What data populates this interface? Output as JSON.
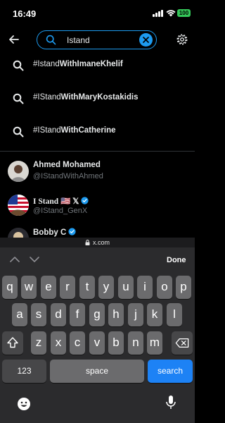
{
  "status_bar": {
    "time": "16:49",
    "battery": "100"
  },
  "search": {
    "query": "Istand"
  },
  "suggestions": [
    {
      "prefix": "#Istand",
      "bold": "WithImaneKhelif"
    },
    {
      "prefix": "#IStand",
      "bold": "WithMaryKostakidis"
    },
    {
      "prefix": "#IStand",
      "bold": "WithCatherine"
    }
  ],
  "users": [
    {
      "name": "Ahmed Mohamed",
      "handle": "@IStandWithAhmed"
    },
    {
      "name": "I Stand 🇺🇸 𝕏",
      "handle": "@IStand_GenX"
    },
    {
      "name": "Bobby C",
      "handle": ""
    }
  ],
  "browser": {
    "url": "x.com"
  },
  "keyboard": {
    "done_label": "Done",
    "row1": [
      "q",
      "w",
      "e",
      "r",
      "t",
      "y",
      "u",
      "i",
      "o",
      "p"
    ],
    "row2": [
      "a",
      "s",
      "d",
      "f",
      "g",
      "h",
      "j",
      "k",
      "l"
    ],
    "row3": [
      "z",
      "x",
      "c",
      "v",
      "b",
      "n",
      "m"
    ],
    "numbers_label": "123",
    "space_label": "space",
    "search_label": "search"
  },
  "colors": {
    "accent": "#1d9bf0",
    "background": "#000000",
    "keyboard": "#2b2b2d"
  }
}
